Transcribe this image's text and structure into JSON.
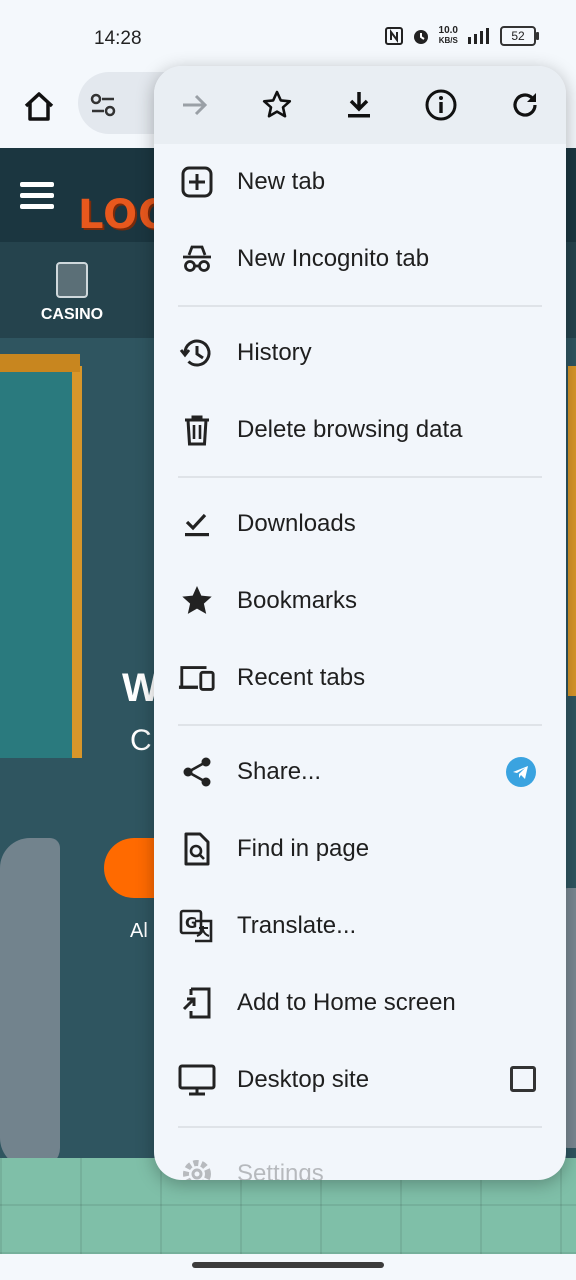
{
  "status_bar": {
    "time": "14:28",
    "net_speed_value": "10.0",
    "net_speed_unit": "KB/S",
    "battery": "52",
    "icons": [
      "nfc-icon",
      "alarm-icon",
      "signal-icon",
      "battery-icon"
    ]
  },
  "toolbar": {
    "home_icon": "home-icon",
    "site_settings_icon": "tune-icon"
  },
  "website": {
    "casino_label": "CASINO",
    "logo_text": "LOO",
    "hero_text_1": "W",
    "hero_text_2": "C",
    "hero_text_3": "Al",
    "accent_color": "#ff6a00"
  },
  "menu": {
    "top_actions": [
      "forward-icon",
      "bookmark-star-icon",
      "download-icon",
      "page-info-icon",
      "reload-icon"
    ],
    "items": [
      {
        "label": "New tab",
        "icon": "new-tab-icon"
      },
      {
        "label": "New Incognito tab",
        "icon": "incognito-icon"
      },
      {
        "label": "History",
        "icon": "history-icon"
      },
      {
        "label": "Delete browsing data",
        "icon": "trash-icon"
      },
      {
        "label": "Downloads",
        "icon": "downloads-icon"
      },
      {
        "label": "Bookmarks",
        "icon": "star-icon"
      },
      {
        "label": "Recent tabs",
        "icon": "devices-icon"
      },
      {
        "label": "Share...",
        "icon": "share-icon"
      },
      {
        "label": "Find in page",
        "icon": "find-in-page-icon"
      },
      {
        "label": "Translate...",
        "icon": "translate-icon"
      },
      {
        "label": "Add to Home screen",
        "icon": "add-to-home-icon"
      },
      {
        "label": "Desktop site",
        "icon": "desktop-icon"
      },
      {
        "label": "Settings",
        "icon": "gear-icon"
      }
    ],
    "share_target_icon": "telegram-icon",
    "desktop_site_checked": false
  }
}
